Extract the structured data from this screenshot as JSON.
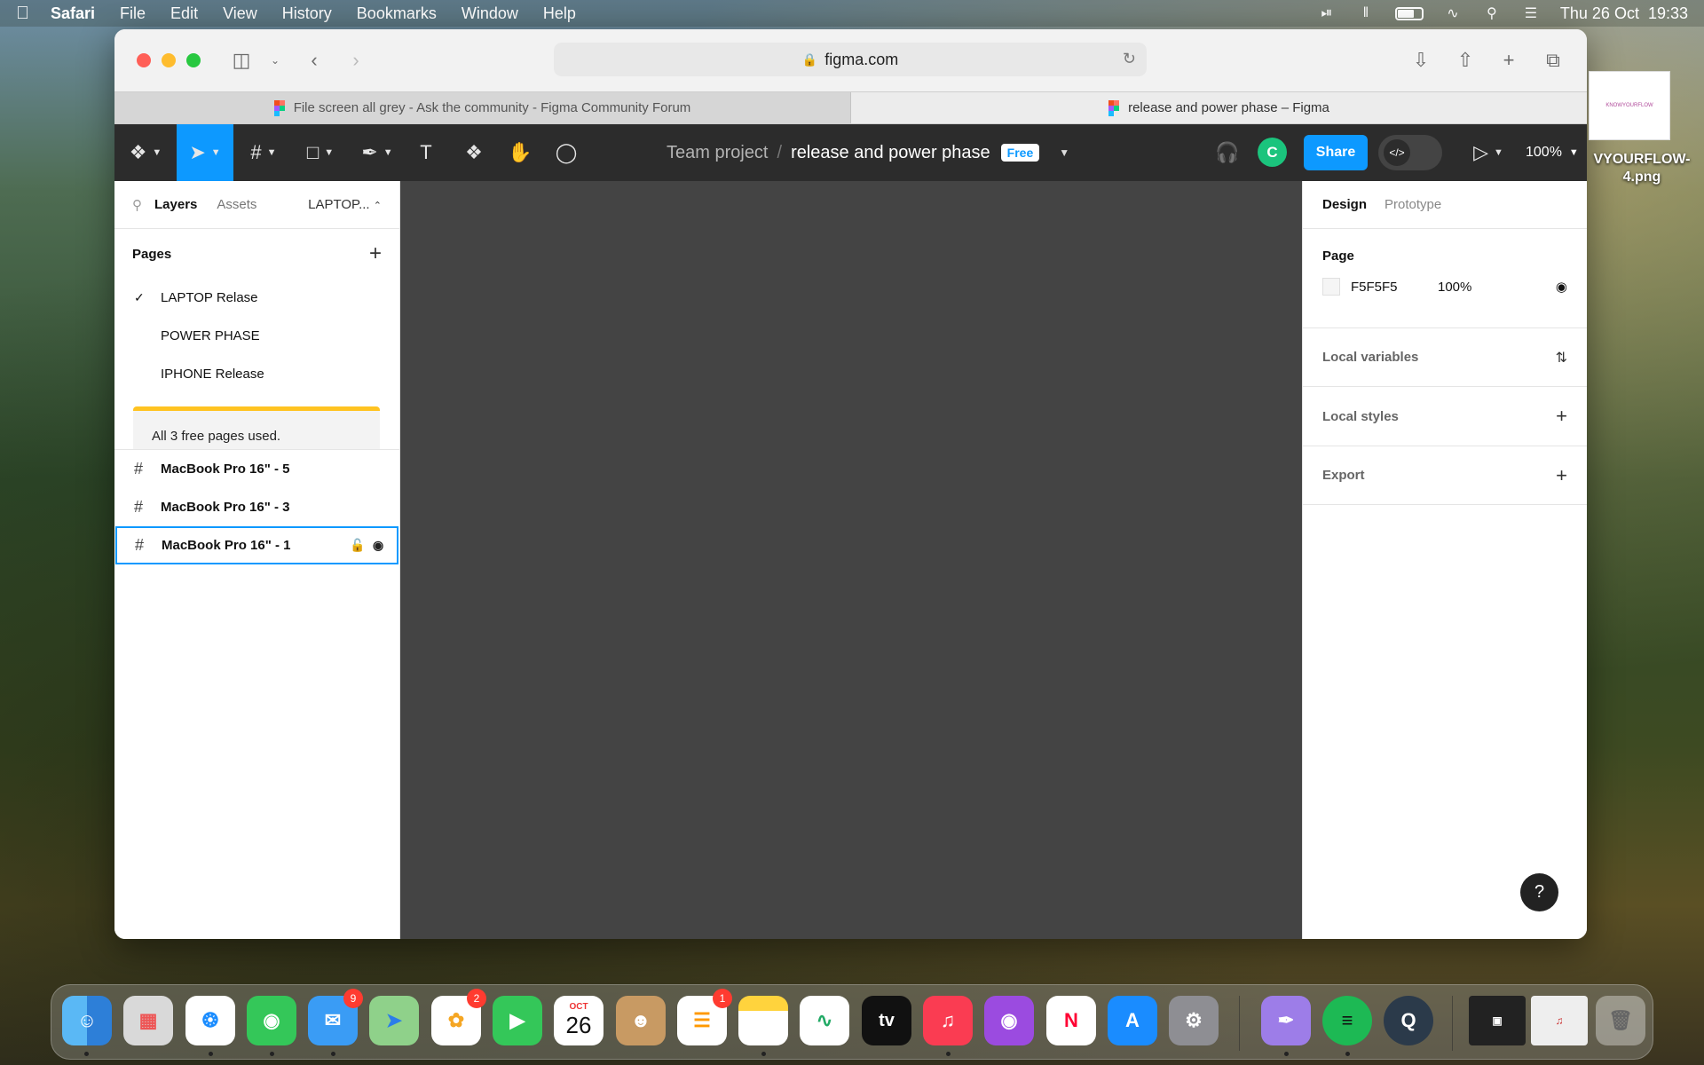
{
  "menubar": {
    "app": "Safari",
    "items": [
      "File",
      "Edit",
      "View",
      "History",
      "Bookmarks",
      "Window",
      "Help"
    ],
    "clock": "Thu 26 Oct  19:33",
    "status_icons": [
      "play-circle-icon",
      "airpods-icon",
      "battery-icon",
      "wifi-icon",
      "search-icon",
      "control-center-icon"
    ]
  },
  "browser": {
    "url": "figma.com",
    "tabs": [
      {
        "label": "File screen all grey - Ask the community - Figma Community Forum",
        "active": false
      },
      {
        "label": "release and power phase – Figma",
        "active": true
      }
    ]
  },
  "figma": {
    "breadcrumb": {
      "team": "Team project",
      "separator": "/",
      "file": "release and power phase",
      "badge": "Free"
    },
    "avatar_initial": "C",
    "share_label": "Share",
    "devmode_icon": "</>",
    "zoom": "100%",
    "left_panel": {
      "tabs": [
        "Layers",
        "Assets"
      ],
      "page_selector": "LAPTOP...",
      "pages_title": "Pages",
      "pages": [
        {
          "name": "LAPTOP Relase",
          "current": true
        },
        {
          "name": "POWER PHASE",
          "current": false
        },
        {
          "name": "IPHONE Release",
          "current": false
        }
      ],
      "limit_notice": "All 3 free pages used.",
      "layers": [
        {
          "name": "MacBook Pro 16\" - 5",
          "selected": false
        },
        {
          "name": "MacBook Pro 16\" - 3",
          "selected": false
        },
        {
          "name": "MacBook Pro 16\" - 1",
          "selected": true
        }
      ]
    },
    "canvas_color": "#444444",
    "right_panel": {
      "tabs": [
        "Design",
        "Prototype"
      ],
      "page_section": {
        "title": "Page",
        "fill_hex": "F5F5F5",
        "opacity": "100%"
      },
      "sections": [
        "Local variables",
        "Local styles",
        "Export"
      ]
    },
    "help_label": "?"
  },
  "desktop": {
    "file_preview_text": "KNOWYOURFLOW",
    "file_label": "VYOURFLOW-\n4.png"
  },
  "dock": {
    "apps": [
      {
        "name": "Finder",
        "badge": ""
      },
      {
        "name": "Launchpad",
        "badge": ""
      },
      {
        "name": "Safari",
        "badge": ""
      },
      {
        "name": "Messages",
        "badge": ""
      },
      {
        "name": "Mail",
        "badge": "9"
      },
      {
        "name": "Maps",
        "badge": ""
      },
      {
        "name": "Photos",
        "badge": "2"
      },
      {
        "name": "FaceTime",
        "badge": ""
      },
      {
        "name": "Calendar",
        "badge": "",
        "month": "OCT",
        "day": "26"
      },
      {
        "name": "Contacts",
        "badge": ""
      },
      {
        "name": "Reminders",
        "badge": "1"
      },
      {
        "name": "Notes",
        "badge": ""
      },
      {
        "name": "Freeform",
        "badge": ""
      },
      {
        "name": "TV",
        "badge": "",
        "text": "tv"
      },
      {
        "name": "Music",
        "badge": ""
      },
      {
        "name": "Podcasts",
        "badge": ""
      },
      {
        "name": "News",
        "badge": ""
      },
      {
        "name": "App Store",
        "badge": ""
      },
      {
        "name": "System Settings",
        "badge": ""
      },
      {
        "name": "Pen App",
        "badge": ""
      },
      {
        "name": "Spotify",
        "badge": ""
      },
      {
        "name": "QuickTime",
        "badge": ""
      },
      {
        "name": "Recent Window",
        "badge": ""
      },
      {
        "name": "Music Window",
        "badge": ""
      },
      {
        "name": "Trash",
        "badge": ""
      }
    ]
  }
}
